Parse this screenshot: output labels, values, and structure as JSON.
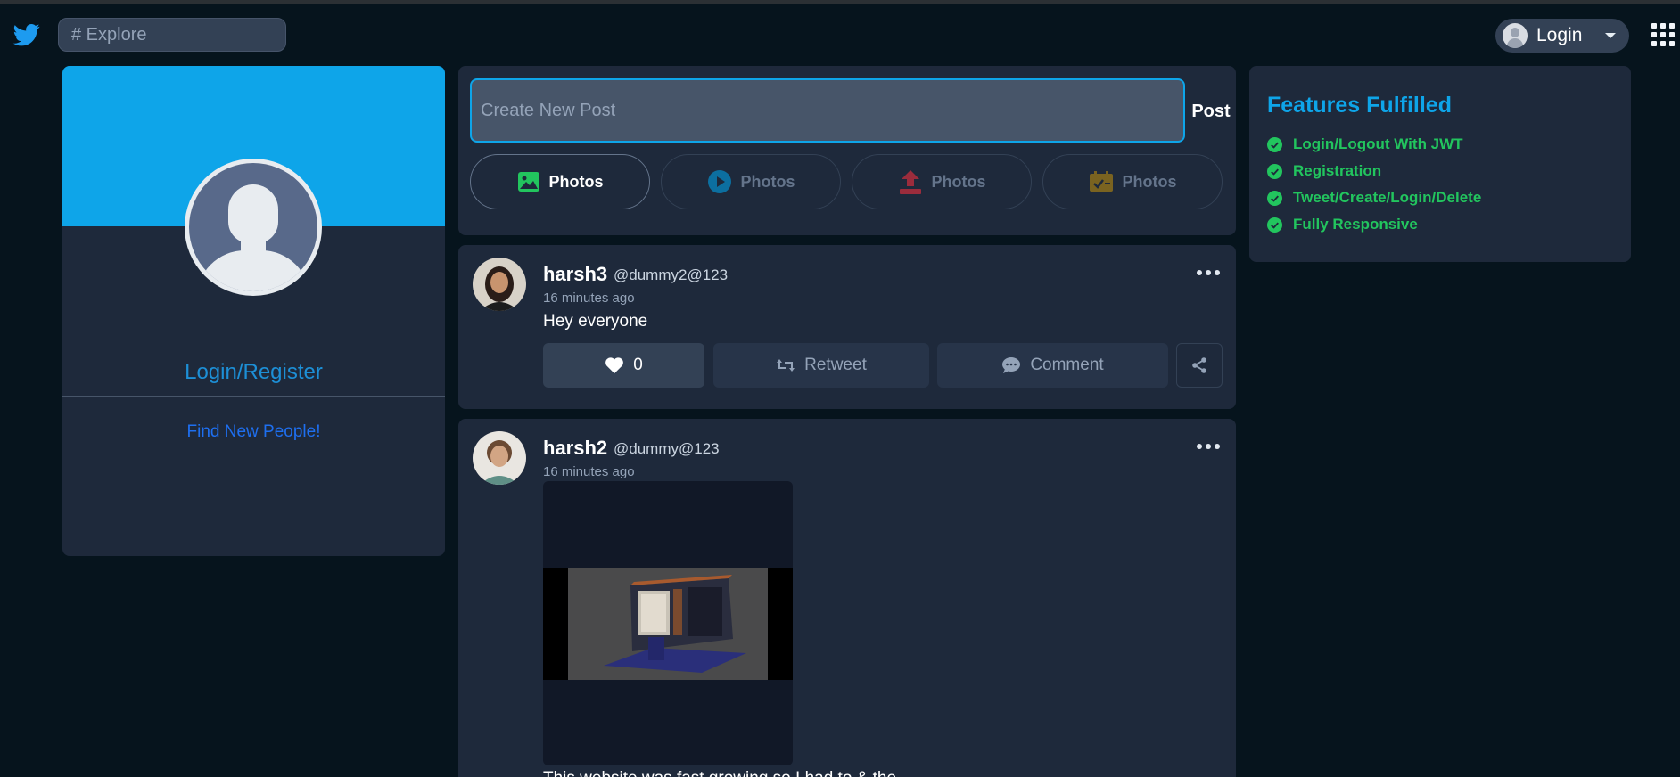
{
  "header": {
    "search_placeholder": "# Explore",
    "login_label": "Login"
  },
  "sidebar": {
    "login_register": "Login/Register",
    "find_people": "Find New People!"
  },
  "composer": {
    "placeholder": "Create New Post",
    "post_label": "Post",
    "media_buttons": [
      {
        "label": "Photos",
        "icon": "image-icon",
        "color": "#22c55e"
      },
      {
        "label": "Photos",
        "icon": "video-icon",
        "color": "#0ea5e9"
      },
      {
        "label": "Photos",
        "icon": "upload-icon",
        "color": "#ef4444"
      },
      {
        "label": "Photos",
        "icon": "calendar-icon",
        "color": "#eab308"
      }
    ]
  },
  "posts": [
    {
      "username": "harsh3",
      "handle": "@dummy2@123",
      "time": "16 minutes ago",
      "text": "Hey everyone",
      "likes": "0",
      "retweet_label": "Retweet",
      "comment_label": "Comment"
    },
    {
      "username": "harsh2",
      "handle": "@dummy@123",
      "time": "16 minutes ago",
      "text": "This website was fast growing so I had to & the"
    }
  ],
  "features": {
    "title": "Features Fulfilled",
    "items": [
      "Login/Logout With JWT",
      "Registration",
      "Tweet/Create/Login/Delete",
      "Fully Responsive"
    ]
  },
  "colors": {
    "accent": "#0ea5e9",
    "success": "#22c55e",
    "background": "#06141d",
    "card": "#1e293b"
  }
}
